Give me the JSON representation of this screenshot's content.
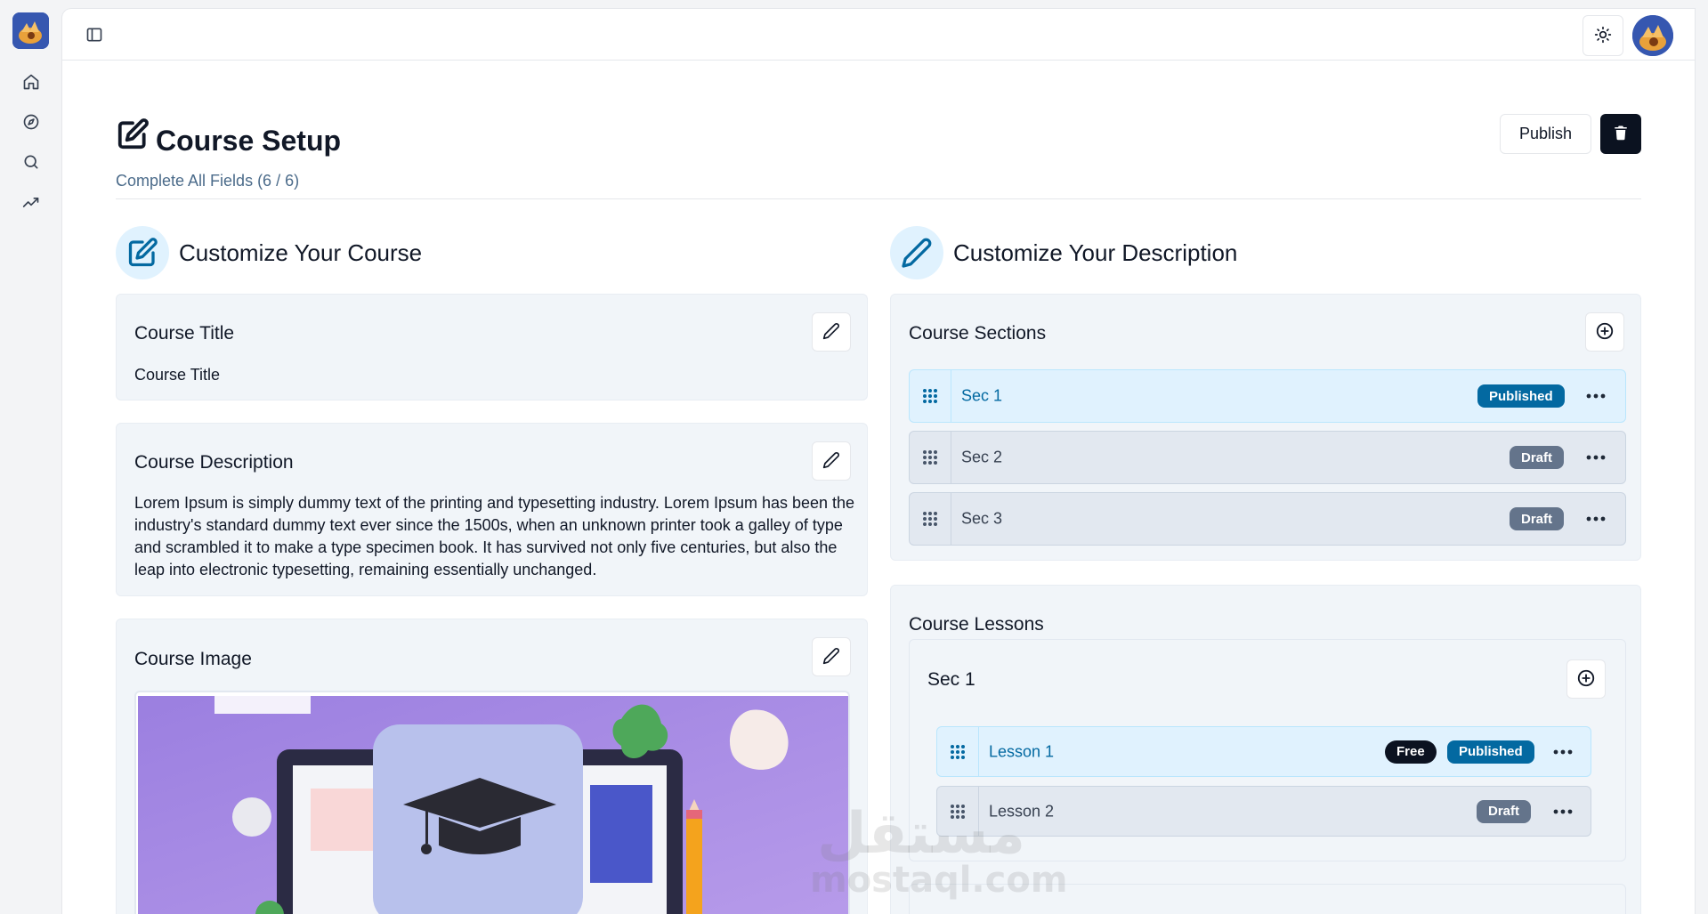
{
  "sidebar": {
    "logo_icon": "app-logo",
    "items": [
      {
        "icon": "home-icon"
      },
      {
        "icon": "compass-icon"
      },
      {
        "icon": "search-icon"
      },
      {
        "icon": "trending-icon"
      }
    ]
  },
  "topbar": {
    "toggle_icon": "sidebar-toggle-icon",
    "theme_icon": "sun-icon"
  },
  "header": {
    "title": "Course Setup",
    "subtitle": "Complete All Fields (6 / 6)",
    "publish_label": "Publish"
  },
  "left": {
    "heading": "Customize Your Course",
    "course_title": {
      "label": "Course Title",
      "value": "Course Title"
    },
    "course_description": {
      "label": "Course Description",
      "value": "Lorem Ipsum is simply dummy text of the printing and typesetting industry. Lorem Ipsum has been the industry's standard dummy text ever since the 1500s, when an unknown printer took a galley of type and scrambled it to make a type specimen book. It has survived not only five centuries, but also the leap into electronic typesetting, remaining essentially unchanged."
    },
    "course_image": {
      "label": "Course Image"
    }
  },
  "right": {
    "heading": "Customize Your Description",
    "sections": {
      "label": "Course Sections",
      "items": [
        {
          "name": "Sec 1",
          "status": "Published"
        },
        {
          "name": "Sec 2",
          "status": "Draft"
        },
        {
          "name": "Sec 3",
          "status": "Draft"
        }
      ]
    },
    "lessons": {
      "label": "Course Lessons",
      "group": {
        "name": "Sec 1",
        "items": [
          {
            "name": "Lesson 1",
            "free": "Free",
            "status": "Published"
          },
          {
            "name": "Lesson 2",
            "status": "Draft"
          }
        ]
      }
    }
  },
  "watermark": {
    "arabic": "مستقل",
    "latin": "mostaql.com"
  },
  "colors": {
    "accent": "#0369a1",
    "accent_bg": "#e0f2fe",
    "draft": "#64748b",
    "dark": "#0b1220"
  }
}
